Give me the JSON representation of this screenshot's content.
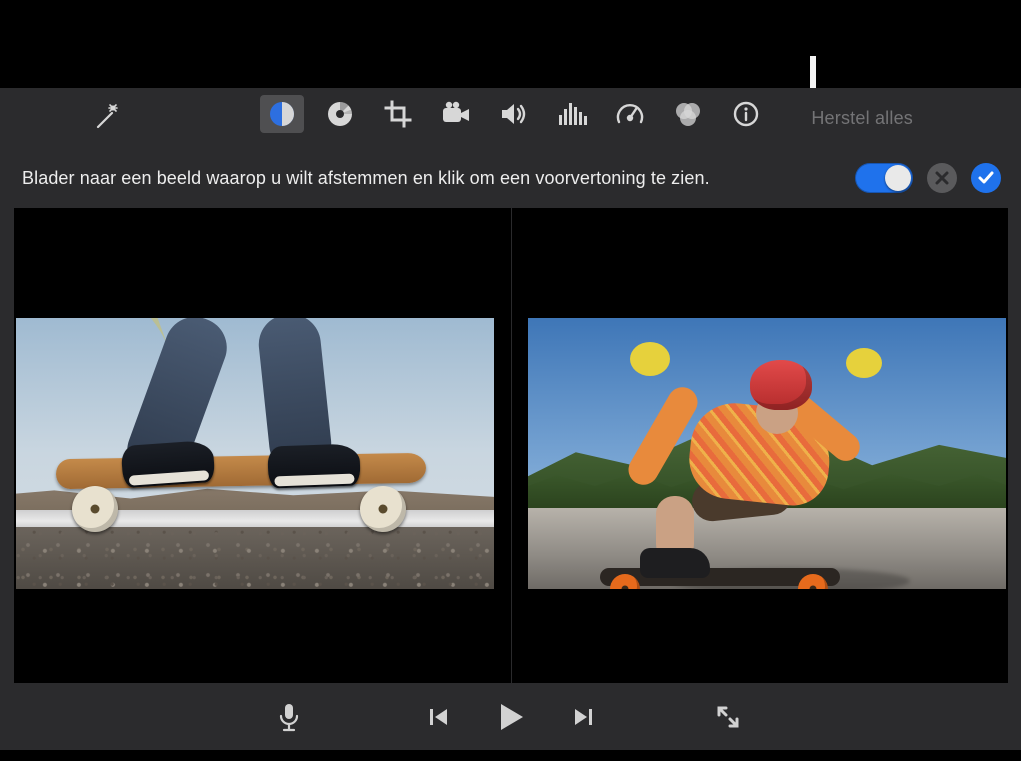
{
  "toolbar": {
    "reset_label": "Herstel alles",
    "tools": [
      {
        "id": "wand",
        "name": "magic-wand-icon"
      },
      {
        "id": "balance",
        "name": "color-balance-icon",
        "active": true
      },
      {
        "id": "palette",
        "name": "color-correction-icon"
      },
      {
        "id": "crop",
        "name": "crop-icon"
      },
      {
        "id": "stabilize",
        "name": "video-camera-icon"
      },
      {
        "id": "volume",
        "name": "volume-icon"
      },
      {
        "id": "eq",
        "name": "equalizer-icon"
      },
      {
        "id": "speed",
        "name": "speedometer-icon"
      },
      {
        "id": "filter",
        "name": "clip-filter-icon"
      },
      {
        "id": "info",
        "name": "info-icon"
      }
    ]
  },
  "hint": {
    "text": "Blader naar een beeld waarop u wilt afstemmen en klik om een voorvertoning te zien."
  },
  "controls": {
    "toggle_on": true
  },
  "viewer": {
    "left_alt": "Referentiebeeld: skateboard op weg",
    "right_alt": "Doelbeeld: skateboarder met rode helm"
  },
  "playback": {
    "mic": "microphone-icon",
    "prev": "previous-frame-icon",
    "play": "play-icon",
    "next": "next-frame-icon",
    "fullscreen": "fullscreen-icon"
  }
}
